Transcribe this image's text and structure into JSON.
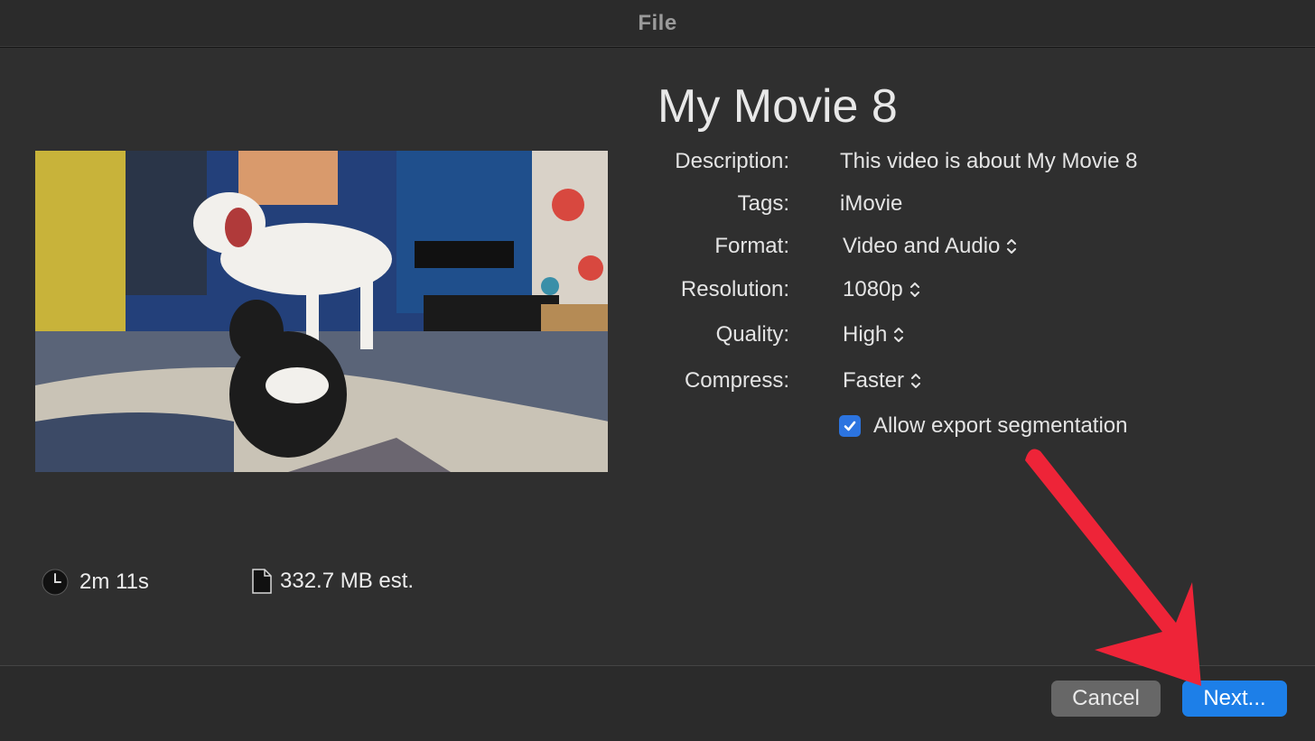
{
  "window": {
    "title": "File"
  },
  "movie": {
    "title": "My Movie 8"
  },
  "fields": {
    "description": {
      "label": "Description:",
      "value": "This video is about My Movie 8"
    },
    "tags": {
      "label": "Tags:",
      "value": "iMovie"
    },
    "format": {
      "label": "Format:",
      "value": "Video and Audio"
    },
    "resolution": {
      "label": "Resolution:",
      "value": "1080p"
    },
    "quality": {
      "label": "Quality:",
      "value": "High"
    },
    "compress": {
      "label": "Compress:",
      "value": "Faster"
    }
  },
  "segmentation": {
    "label": "Allow export segmentation",
    "checked": true
  },
  "stats": {
    "duration": "2m 11s",
    "size": "332.7 MB est."
  },
  "buttons": {
    "cancel": "Cancel",
    "next": "Next..."
  },
  "colors": {
    "accent": "#1d7fe8",
    "arrow": "#ee2438",
    "checkbox": "#2c74e0"
  },
  "icons": [
    "clock-icon",
    "document-icon",
    "chevron-updown-icon",
    "checkmark-icon"
  ]
}
